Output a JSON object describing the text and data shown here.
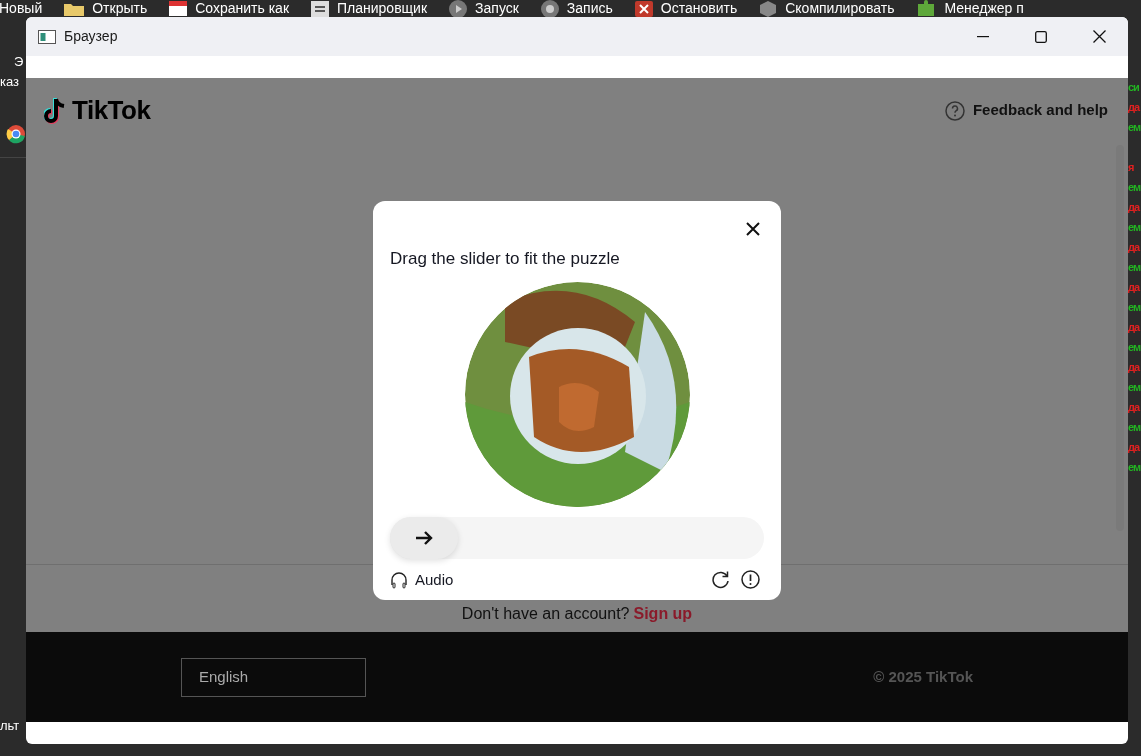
{
  "desktop": {
    "toolbar": [
      {
        "label": "Новый"
      },
      {
        "label": "Открыть"
      },
      {
        "label": "Сохранить как"
      },
      {
        "label": "Планировщик"
      },
      {
        "label": "Запуск"
      },
      {
        "label": "Запись"
      },
      {
        "label": "Остановить"
      },
      {
        "label": "Скомпилировать"
      },
      {
        "label": "Менеджер п"
      }
    ],
    "left_fragments": [
      "Э",
      "каз"
    ],
    "bottom_fragment": "льт",
    "right_log": [
      {
        "text": "си",
        "color": "#22b422"
      },
      {
        "text": "да",
        "color": "#e02020"
      },
      {
        "text": "ем",
        "color": "#22b422"
      },
      {
        "text": "я",
        "color": "#e02020"
      },
      {
        "text": "ем",
        "color": "#22b422"
      },
      {
        "text": "да",
        "color": "#e02020"
      },
      {
        "text": "ем",
        "color": "#22b422"
      },
      {
        "text": "да",
        "color": "#e02020"
      },
      {
        "text": "ем",
        "color": "#22b422"
      },
      {
        "text": "да",
        "color": "#e02020"
      },
      {
        "text": "ем",
        "color": "#22b422"
      },
      {
        "text": "да",
        "color": "#e02020"
      },
      {
        "text": "ем",
        "color": "#22b422"
      },
      {
        "text": "да",
        "color": "#e02020"
      },
      {
        "text": "ем",
        "color": "#22b422"
      },
      {
        "text": "да",
        "color": "#e02020"
      },
      {
        "text": "ем",
        "color": "#22b422"
      },
      {
        "text": "да",
        "color": "#e02020"
      },
      {
        "text": "ем",
        "color": "#22b422"
      }
    ]
  },
  "window": {
    "title": "Браузер"
  },
  "page": {
    "logo": "TikTok",
    "help_link": "Feedback and help",
    "signup_prompt": "Don't have an account?",
    "signup_link": "Sign up",
    "footer": {
      "language": "English",
      "copyright": "© 2025 TikTok"
    }
  },
  "captcha": {
    "title": "Drag the slider to fit the puzzle",
    "slider": {
      "level": 0
    },
    "audio_label": "Audio"
  }
}
